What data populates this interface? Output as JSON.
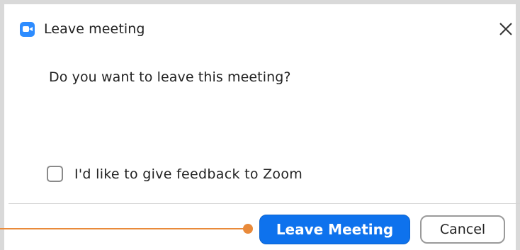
{
  "window": {
    "title": "Leave meeting",
    "app_icon": "zoom-camera-icon",
    "close_icon": "close-icon"
  },
  "dialog": {
    "question": "Do you want to leave this meeting?",
    "feedback_checkbox": {
      "label": "I'd like to give feedback to Zoom",
      "checked": false
    }
  },
  "buttons": {
    "leave_label": "Leave Meeting",
    "cancel_label": "Cancel"
  },
  "colors": {
    "primary_button": "#0e72ed",
    "zoom_icon": "#2d8cff",
    "annotation_pointer": "#e98a3a"
  }
}
